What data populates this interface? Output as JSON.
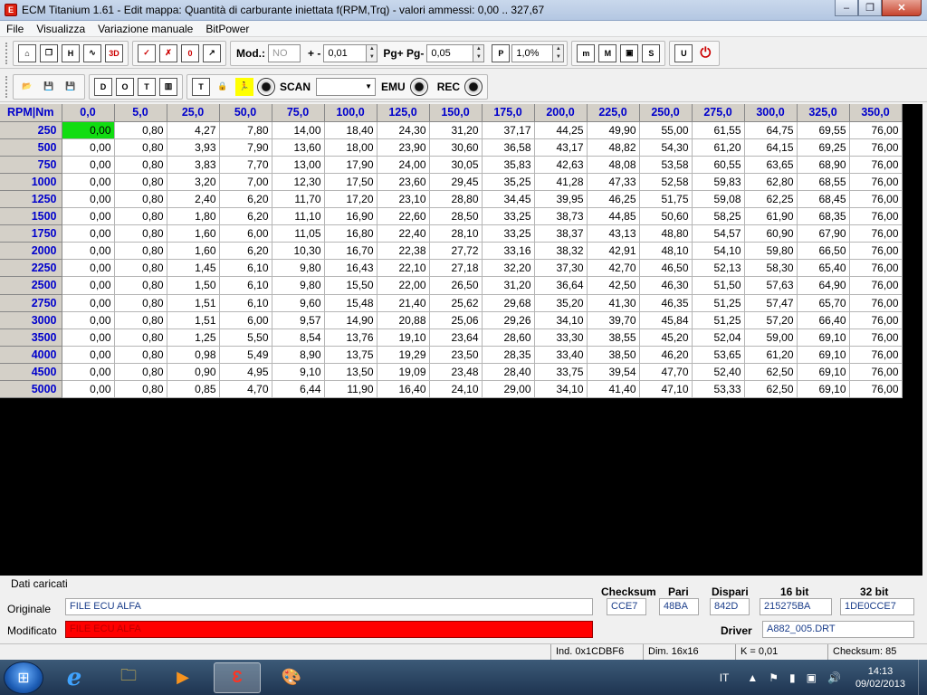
{
  "window": {
    "app_icon": "E",
    "title": "ECM Titanium 1.61 - Edit mappa: Quantità di carburante iniettata f(RPM,Trq) - valori ammessi: 0,00 .. 327,67",
    "minimize": "–",
    "maximize": "❐",
    "close": "✕"
  },
  "menu": [
    "File",
    "Visualizza",
    "Variazione manuale",
    "BitPower"
  ],
  "toolbar1": {
    "group1_icons": [
      "home-icon",
      "copy-icon",
      "h-icon",
      "chart-icon",
      "3d-icon"
    ],
    "group1_labels": [
      "⌂",
      "❐",
      "H",
      "∿",
      "3D"
    ],
    "group2_icons": [
      "check-icon",
      "x-icon",
      "zero-icon",
      "arrow-icon"
    ],
    "group2_labels": [
      "✓",
      "✗",
      "0",
      "↗"
    ],
    "mod_label": "Mod.:",
    "mod_value": "NO",
    "plusminus_label": "+ -",
    "plusminus_value": "0,01",
    "pg_label": "Pg+ Pg-",
    "pg_value": "0,05",
    "p_button": "P",
    "percent_value": "1,0%",
    "group4_labels": [
      "m",
      "M",
      "▣",
      "S"
    ],
    "u_button": "U",
    "power_icon": "⏻"
  },
  "toolbar2": {
    "group1_labels": [
      "📂",
      "💾",
      "💾"
    ],
    "group2_labels": [
      "D",
      "O",
      "T",
      "▥"
    ],
    "group3_labels": [
      "T",
      "🔒",
      "🏃"
    ],
    "scan_label": "SCAN",
    "emu_label": "EMU",
    "rec_label": "REC"
  },
  "map": {
    "corner": "RPM|Nm",
    "columns": [
      "0,0",
      "5,0",
      "25,0",
      "50,0",
      "75,0",
      "100,0",
      "125,0",
      "150,0",
      "175,0",
      "200,0",
      "225,0",
      "250,0",
      "275,0",
      "300,0",
      "325,0",
      "350,0"
    ],
    "rows": [
      {
        "rpm": "250",
        "values": [
          "0,00",
          "0,80",
          "4,27",
          "7,80",
          "14,00",
          "18,40",
          "24,30",
          "31,20",
          "37,17",
          "44,25",
          "49,90",
          "55,00",
          "61,55",
          "64,75",
          "69,55",
          "76,00"
        ]
      },
      {
        "rpm": "500",
        "values": [
          "0,00",
          "0,80",
          "3,93",
          "7,90",
          "13,60",
          "18,00",
          "23,90",
          "30,60",
          "36,58",
          "43,17",
          "48,82",
          "54,30",
          "61,20",
          "64,15",
          "69,25",
          "76,00"
        ]
      },
      {
        "rpm": "750",
        "values": [
          "0,00",
          "0,80",
          "3,83",
          "7,70",
          "13,00",
          "17,90",
          "24,00",
          "30,05",
          "35,83",
          "42,63",
          "48,08",
          "53,58",
          "60,55",
          "63,65",
          "68,90",
          "76,00"
        ]
      },
      {
        "rpm": "1000",
        "values": [
          "0,00",
          "0,80",
          "3,20",
          "7,00",
          "12,30",
          "17,50",
          "23,60",
          "29,45",
          "35,25",
          "41,28",
          "47,33",
          "52,58",
          "59,83",
          "62,80",
          "68,55",
          "76,00"
        ]
      },
      {
        "rpm": "1250",
        "values": [
          "0,00",
          "0,80",
          "2,40",
          "6,20",
          "11,70",
          "17,20",
          "23,10",
          "28,80",
          "34,45",
          "39,95",
          "46,25",
          "51,75",
          "59,08",
          "62,25",
          "68,45",
          "76,00"
        ]
      },
      {
        "rpm": "1500",
        "values": [
          "0,00",
          "0,80",
          "1,80",
          "6,20",
          "11,10",
          "16,90",
          "22,60",
          "28,50",
          "33,25",
          "38,73",
          "44,85",
          "50,60",
          "58,25",
          "61,90",
          "68,35",
          "76,00"
        ]
      },
      {
        "rpm": "1750",
        "values": [
          "0,00",
          "0,80",
          "1,60",
          "6,00",
          "11,05",
          "16,80",
          "22,40",
          "28,10",
          "33,25",
          "38,37",
          "43,13",
          "48,80",
          "54,57",
          "60,90",
          "67,90",
          "76,00"
        ]
      },
      {
        "rpm": "2000",
        "values": [
          "0,00",
          "0,80",
          "1,60",
          "6,20",
          "10,30",
          "16,70",
          "22,38",
          "27,72",
          "33,16",
          "38,32",
          "42,91",
          "48,10",
          "54,10",
          "59,80",
          "66,50",
          "76,00"
        ]
      },
      {
        "rpm": "2250",
        "values": [
          "0,00",
          "0,80",
          "1,45",
          "6,10",
          "9,80",
          "16,43",
          "22,10",
          "27,18",
          "32,20",
          "37,30",
          "42,70",
          "46,50",
          "52,13",
          "58,30",
          "65,40",
          "76,00"
        ]
      },
      {
        "rpm": "2500",
        "values": [
          "0,00",
          "0,80",
          "1,50",
          "6,10",
          "9,80",
          "15,50",
          "22,00",
          "26,50",
          "31,20",
          "36,64",
          "42,50",
          "46,30",
          "51,50",
          "57,63",
          "64,90",
          "76,00"
        ]
      },
      {
        "rpm": "2750",
        "values": [
          "0,00",
          "0,80",
          "1,51",
          "6,10",
          "9,60",
          "15,48",
          "21,40",
          "25,62",
          "29,68",
          "35,20",
          "41,30",
          "46,35",
          "51,25",
          "57,47",
          "65,70",
          "76,00"
        ]
      },
      {
        "rpm": "3000",
        "values": [
          "0,00",
          "0,80",
          "1,51",
          "6,00",
          "9,57",
          "14,90",
          "20,88",
          "25,06",
          "29,26",
          "34,10",
          "39,70",
          "45,84",
          "51,25",
          "57,20",
          "66,40",
          "76,00"
        ]
      },
      {
        "rpm": "3500",
        "values": [
          "0,00",
          "0,80",
          "1,25",
          "5,50",
          "8,54",
          "13,76",
          "19,10",
          "23,64",
          "28,60",
          "33,30",
          "38,55",
          "45,20",
          "52,04",
          "59,00",
          "69,10",
          "76,00"
        ]
      },
      {
        "rpm": "4000",
        "values": [
          "0,00",
          "0,80",
          "0,98",
          "5,49",
          "8,90",
          "13,75",
          "19,29",
          "23,50",
          "28,35",
          "33,40",
          "38,50",
          "46,20",
          "53,65",
          "61,20",
          "69,10",
          "76,00"
        ]
      },
      {
        "rpm": "4500",
        "values": [
          "0,00",
          "0,80",
          "0,90",
          "4,95",
          "9,10",
          "13,50",
          "19,09",
          "23,48",
          "28,40",
          "33,75",
          "39,54",
          "47,70",
          "52,40",
          "62,50",
          "69,10",
          "76,00"
        ]
      },
      {
        "rpm": "5000",
        "values": [
          "0,00",
          "0,80",
          "0,85",
          "4,70",
          "6,44",
          "11,90",
          "16,40",
          "24,10",
          "29,00",
          "34,10",
          "41,40",
          "47,10",
          "53,33",
          "62,50",
          "69,10",
          "76,00"
        ]
      }
    ],
    "selected_color": "#11dd11"
  },
  "info": {
    "dati_caricati": "Dati caricati",
    "originale_label": "Originale",
    "originale_value": "FILE ECU ALFA",
    "modificato_label": "Modificato",
    "modificato_value": "FILE ECU ALFA",
    "checksum_header": "Checksum",
    "pari_header": "Pari",
    "dispari_header": "Dispari",
    "bit16_header": "16 bit",
    "bit32_header": "32 bit",
    "checksum_value": "CCE7",
    "pari_value": "48BA",
    "dispari_value": "842D",
    "bit16_value": "215275BA",
    "bit32_value": "1DE0CCE7",
    "driver_label": "Driver",
    "driver_value": "A882_005.DRT"
  },
  "status": {
    "ind": "Ind. 0x1CDBF6",
    "dim": "Dim. 16x16",
    "k": "K = 0,01",
    "checksum": "Checksum: 85"
  },
  "taskbar": {
    "start": "⊞",
    "ie": "e",
    "explorer": "🗀",
    "media": "▶",
    "ecm": "Ɛ",
    "paint": "🎨",
    "lang": "IT",
    "tray_up": "▲",
    "tray_flag": "⚑",
    "tray_battery": "▮",
    "tray_network": "▣",
    "tray_volume": "🔊",
    "time": "14:13",
    "date": "09/02/2013"
  }
}
